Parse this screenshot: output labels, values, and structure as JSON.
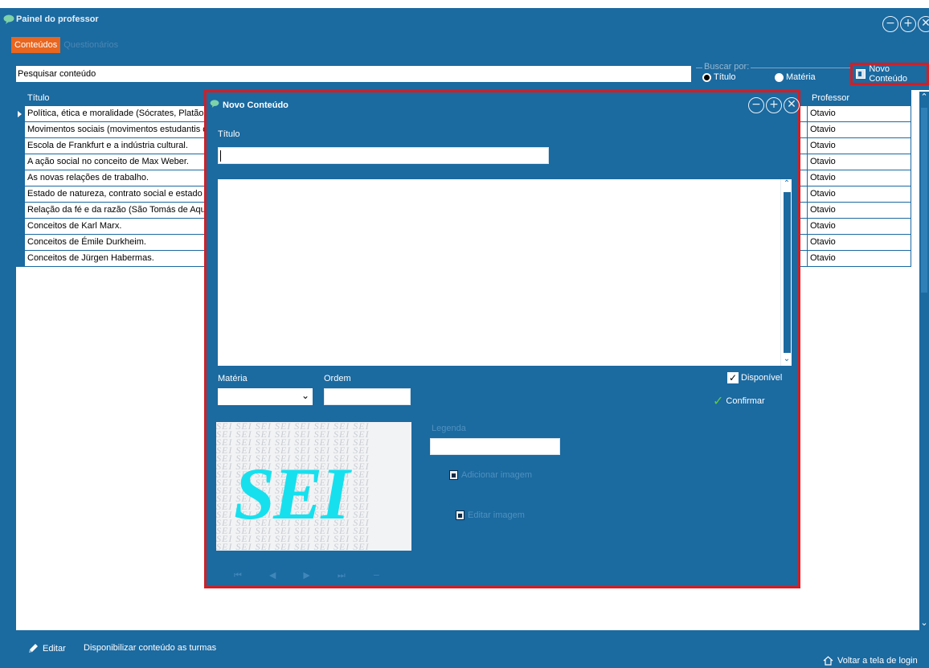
{
  "window": {
    "title": "Painel do professor",
    "icon": "brain-icon",
    "controls": [
      "−",
      "+",
      "✕"
    ]
  },
  "tabs": [
    {
      "label": "Conteúdos",
      "active": true
    },
    {
      "label": "Questionários",
      "active": false
    }
  ],
  "search": {
    "value": "Pesquisar conteúdo",
    "buscar_por_label": "Buscar por:",
    "options": [
      {
        "label": "Título",
        "selected": true
      },
      {
        "label": "Matéria",
        "selected": false
      }
    ]
  },
  "toolbar": {
    "novo_conteudo_label": "Novo Conteúdo"
  },
  "grid": {
    "columns": [
      "Título",
      "Professor"
    ],
    "rows": [
      {
        "titulo": "Política, ética e moralidade (Sócrates, Platão e",
        "professor": "Otavio"
      },
      {
        "titulo": "Movimentos sociais (movimentos estudantis de",
        "professor": "Otavio"
      },
      {
        "titulo": "Escola de Frankfurt e a indústria cultural.",
        "professor": "Otavio"
      },
      {
        "titulo": "A ação social no conceito de Max Weber.",
        "professor": "Otavio"
      },
      {
        "titulo": "As novas relações de trabalho.",
        "professor": "Otavio"
      },
      {
        "titulo": "Estado de natureza, contrato social e estado d",
        "professor": "Otavio"
      },
      {
        "titulo": "Relação da fé e da razão (São Tomás de Aqui",
        "professor": "Otavio"
      },
      {
        "titulo": "Conceitos de Karl Marx.",
        "professor": "Otavio"
      },
      {
        "titulo": "Conceitos de Émile Durkheim.",
        "professor": "Otavio"
      },
      {
        "titulo": "Conceitos de Jürgen Habermas.",
        "professor": "Otavio"
      }
    ]
  },
  "footer": {
    "editar_label": "Editar",
    "disponibilizar_label": "Disponibilizar conteúdo as turmas",
    "voltar_label": "Voltar a tela de login"
  },
  "dialog": {
    "title": "Novo Conteúdo",
    "titulo_label": "Título",
    "titulo_value": "",
    "content_value": "",
    "materia_label": "Matéria",
    "materia_value": "",
    "ordem_label": "Ordem",
    "ordem_value": "",
    "disponivel_label": "Disponível",
    "disponivel_checked": true,
    "confirmar_label": "Confirmar",
    "legenda_label": "Legenda",
    "legenda_value": "",
    "adicionar_imagem_label": "Adicionar imagem",
    "editar_imagem_label": "Editar imagem",
    "image_text": "SEI",
    "image_pattern_text": "SEI SEI SEI SEI SEI SEI SEI SEI",
    "nav_buttons": [
      "⏮",
      "◀",
      "▶",
      "⏭",
      "−"
    ]
  },
  "colors": {
    "window_bg": "#1b6aa0",
    "active_tab": "#e8661f",
    "highlight_border": "#d21e25",
    "logo_text": "#16e0ee",
    "confirm_check": "#5fcb3e"
  }
}
